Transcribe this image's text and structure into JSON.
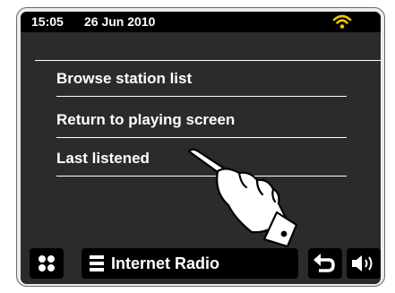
{
  "status_bar": {
    "time": "15:05",
    "date": "26 Jun 2010",
    "wifi_icon": "wifi-icon",
    "wifi_color": "#f2c200"
  },
  "menu": {
    "items": [
      {
        "label": "Browse station list"
      },
      {
        "label": "Return to playing screen"
      },
      {
        "label": "Last listened"
      }
    ]
  },
  "bottom_bar": {
    "home_icon": "home-grid-icon",
    "mode_icon": "menu-icon",
    "mode_label": "Internet Radio",
    "back_icon": "back-arrow-icon",
    "volume_icon": "volume-icon"
  },
  "colors": {
    "screen_bg": "#2b2b2b",
    "bar_bg": "#000000",
    "text": "#ffffff"
  }
}
